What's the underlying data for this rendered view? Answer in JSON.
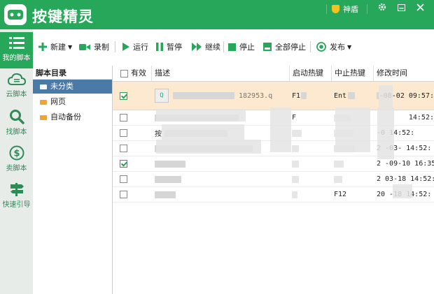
{
  "app": {
    "title": "按键精灵",
    "vip_label": "神盾"
  },
  "window": {
    "settings_icon": "gear-icon",
    "minimize_icon": "minimize-icon",
    "maximize_icon": "maximize-icon"
  },
  "sidebar": {
    "items": [
      {
        "label": "我的脚本",
        "icon": "list-icon",
        "active": true
      },
      {
        "label": "云脚本",
        "icon": "cloud-icon",
        "active": false
      },
      {
        "label": "找脚本",
        "icon": "search-icon",
        "active": false
      },
      {
        "label": "卖脚本",
        "icon": "dollar-icon",
        "active": false
      },
      {
        "label": "快速引导",
        "icon": "signpost-icon",
        "active": false
      }
    ]
  },
  "toolbar": {
    "new_label": "新建",
    "record_label": "录制",
    "run_label": "运行",
    "pause_label": "暂停",
    "resume_label": "继续",
    "stop_label": "停止",
    "stop_all_label": "全部停止",
    "publish_label": "发布"
  },
  "tree": {
    "header": "脚本目录",
    "items": [
      {
        "label": "未分类",
        "selected": true
      },
      {
        "label": "网页",
        "selected": false
      },
      {
        "label": "自动备份",
        "selected": false
      }
    ]
  },
  "grid": {
    "columns": {
      "enabled": "有效",
      "description": "描述",
      "start_hotkey": "启动热键",
      "stop_hotkey": "中止热键",
      "modified": "修改时间"
    },
    "rows": [
      {
        "checked": true,
        "description": "182953.q",
        "start_hotkey": "F1",
        "stop_hotkey": "Ent",
        "modified": "-08-02 09:57:",
        "highlight": true
      },
      {
        "checked": false,
        "description": "",
        "start_hotkey": "F",
        "stop_hotkey": "",
        "modified": "14:52:",
        "highlight": false
      },
      {
        "checked": false,
        "description": "按",
        "start_hotkey": "",
        "stop_hotkey": "",
        "modified": "-0  14:52:",
        "highlight": false
      },
      {
        "checked": false,
        "description": "",
        "start_hotkey": "",
        "stop_hotkey": "",
        "modified": "2 -03- 14:52:",
        "highlight": false
      },
      {
        "checked": true,
        "description": "",
        "start_hotkey": "",
        "stop_hotkey": "",
        "modified": "2 -09-10 16:35:",
        "highlight": false
      },
      {
        "checked": false,
        "description": "",
        "start_hotkey": "",
        "stop_hotkey": "",
        "modified": "2 03-18 14:52:",
        "highlight": false
      },
      {
        "checked": false,
        "description": "",
        "start_hotkey": "",
        "stop_hotkey": "F12",
        "modified": "20 -18 14:52:",
        "highlight": false
      }
    ]
  }
}
